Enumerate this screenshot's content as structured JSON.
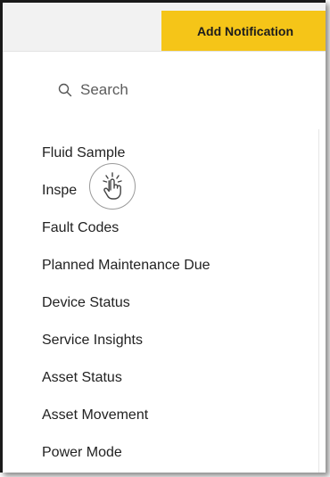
{
  "toolbar": {
    "add_label": "Add Notification"
  },
  "search": {
    "placeholder": "Search",
    "icon": "search-icon"
  },
  "colors": {
    "accent": "#f5c518",
    "text": "#222222"
  },
  "notification_types": [
    "Fluid Sample",
    "Inspe",
    "Fault Codes",
    "Planned Maintenance Due",
    "Device Status",
    "Service Insights",
    "Asset Status",
    "Asset Movement",
    "Power Mode"
  ],
  "cursor": {
    "icon": "tap-hand-icon"
  }
}
